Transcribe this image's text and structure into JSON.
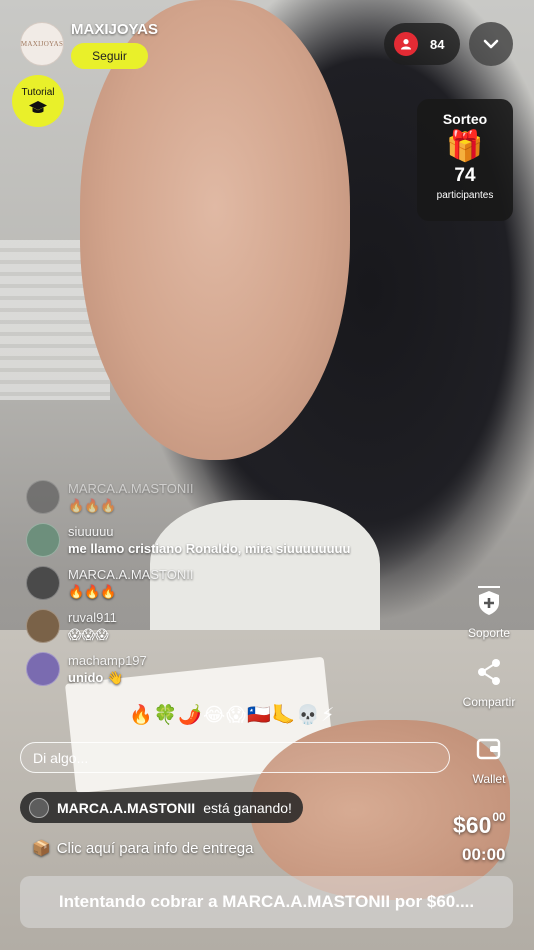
{
  "header": {
    "channel_name": "MAXIJOYAS",
    "avatar_text": "MAXIJOYAS",
    "follow_label": "Seguir",
    "tutorial_label": "Tutorial",
    "viewer_count": "84"
  },
  "raffle": {
    "title": "Sorteo",
    "icon": "gift-icon",
    "count": "74",
    "caption": "participantes"
  },
  "chat": [
    {
      "user": "MARCA.A.MASTONII",
      "text": "🔥🔥🔥",
      "avatar_color": "#4a4a4a"
    },
    {
      "user": "siuuuuu",
      "text": "me llamo cristiano Ronaldo, mira siuuuuuuuu",
      "avatar_color": "#6d8f7c"
    },
    {
      "user": "MARCA.A.MASTONII",
      "text": "🔥🔥🔥",
      "avatar_color": "#4a4a4a"
    },
    {
      "user": "ruval911",
      "text": "😱😱😱",
      "avatar_color": "#7a6248"
    },
    {
      "user": "machamp197",
      "text": "unido 👋",
      "avatar_color": "#7a6bb0"
    }
  ],
  "sidebar": {
    "support_label": "Soporte",
    "share_label": "Compartir",
    "wallet_label": "Wallet"
  },
  "quick_emojis": "🔥🍀🌶️😂😱🇨🇱🦶💀⚡",
  "input": {
    "placeholder": "Di algo..."
  },
  "winner": {
    "user": "MARCA.A.MASTONII",
    "suffix": "está ganando!"
  },
  "delivery": {
    "icon": "📦",
    "label": "Clic aquí para info de entrega"
  },
  "auction": {
    "price": "$60",
    "cents": "00",
    "timer": "00:00"
  },
  "status": {
    "text": "Intentando cobrar a MARCA.A.MASTONII por $60...."
  },
  "colors": {
    "accent": "#e9f02a",
    "live_red": "#e32b34"
  }
}
